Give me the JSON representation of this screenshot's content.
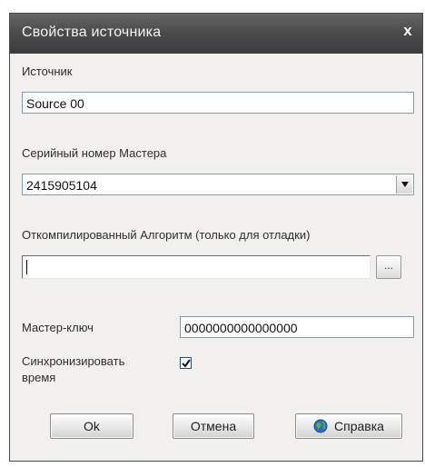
{
  "window": {
    "title": "Свойства источника",
    "close_glyph": "x"
  },
  "source": {
    "label": "Источник",
    "value": "Source 00"
  },
  "master_serial": {
    "label": "Серийный номер Мастера",
    "value": "2415905104"
  },
  "compiled_algorithm": {
    "label": "Откомпилированный Алгоритм (только для отладки)",
    "value": "",
    "browse_label": "..."
  },
  "master_key": {
    "label": "Мастер-ключ",
    "value": "0000000000000000"
  },
  "sync_time": {
    "label_line1": "Синхронизировать",
    "label_line2": "время",
    "checked": true
  },
  "buttons": {
    "ok": "Ok",
    "cancel": "Отмена",
    "help": "Справка"
  },
  "colors": {
    "titlebar": "#4c4c4c",
    "dialog_bg": "#f1f0ec",
    "field_border": "#7f9db9"
  },
  "icons": {
    "close": "close-icon",
    "dropdown": "chevron-down-icon",
    "help": "help-globe-icon",
    "checkmark": "checkmark-icon"
  }
}
